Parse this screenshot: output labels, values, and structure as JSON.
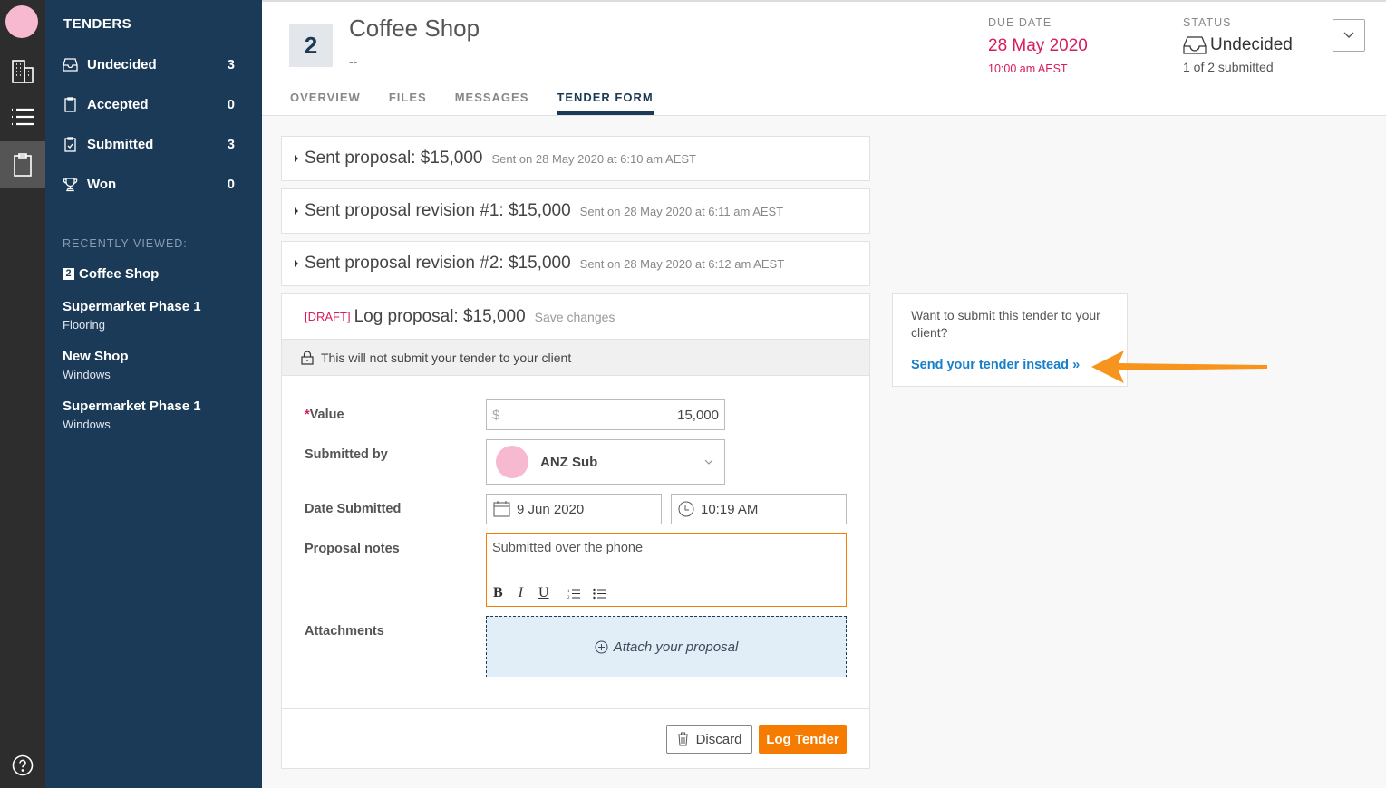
{
  "rail": {
    "icons": [
      "user-avatar",
      "buildings-icon",
      "list-icon",
      "clipboard-icon",
      "help-icon"
    ]
  },
  "sidebar": {
    "title": "TENDERS",
    "items": [
      {
        "label": "Undecided",
        "count": "3",
        "icon": "inbox-icon"
      },
      {
        "label": "Accepted",
        "count": "0",
        "icon": "clipboard-icon"
      },
      {
        "label": "Submitted",
        "count": "3",
        "icon": "clipboard-check-icon"
      },
      {
        "label": "Won",
        "count": "0",
        "icon": "trophy-icon"
      }
    ],
    "recent_label": "RECENTLY VIEWED:",
    "recent": [
      {
        "badge": "2",
        "title": "Coffee Shop",
        "subtitle": ""
      },
      {
        "title": "Supermarket Phase 1",
        "subtitle": "Flooring"
      },
      {
        "title": "New Shop",
        "subtitle": "Windows"
      },
      {
        "title": "Supermarket Phase 1",
        "subtitle": "Windows"
      }
    ]
  },
  "header": {
    "number": "2",
    "title": "Coffee Shop",
    "subtitle": "--",
    "tabs": [
      "OVERVIEW",
      "FILES",
      "MESSAGES",
      "TENDER FORM"
    ],
    "active_tab": "TENDER FORM",
    "due_label": "DUE DATE",
    "due_date": "28 May 2020",
    "due_time": "10:00 am AEST",
    "status_label": "STATUS",
    "status": "Undecided",
    "status_sub": "1 of 2 submitted"
  },
  "proposals": [
    {
      "title": "Sent proposal: $15,000",
      "meta": "Sent on 28 May 2020 at 6:10 am AEST"
    },
    {
      "title": "Sent proposal revision #1: $15,000",
      "meta": "Sent on 28 May 2020 at 6:11 am AEST"
    },
    {
      "title": "Sent proposal revision #2: $15,000",
      "meta": "Sent on 28 May 2020 at 6:12 am AEST"
    }
  ],
  "draft": {
    "tag": "[DRAFT]",
    "title": "Log proposal: $15,000",
    "save_label": "Save changes",
    "notice": "This will not submit your tender to your client",
    "fields": {
      "value_label": "Value",
      "value_required": "*",
      "currency": "$",
      "value": "15,000",
      "submitted_by_label": "Submitted by",
      "submitted_by": "ANZ Sub",
      "date_label": "Date Submitted",
      "date": "9 Jun 2020",
      "time": "10:19 AM",
      "notes_label": "Proposal notes",
      "notes": "Submitted over the phone",
      "attachments_label": "Attachments",
      "attach_prompt": "Attach your proposal"
    },
    "discard_label": "Discard",
    "log_label": "Log Tender"
  },
  "side_box": {
    "question": "Want to submit this tender to your client?",
    "link": "Send your tender instead »"
  },
  "colors": {
    "accent": "#f57c00",
    "sidebar": "#1b3a57",
    "due": "#d81b60",
    "link": "#1a7fc9"
  }
}
